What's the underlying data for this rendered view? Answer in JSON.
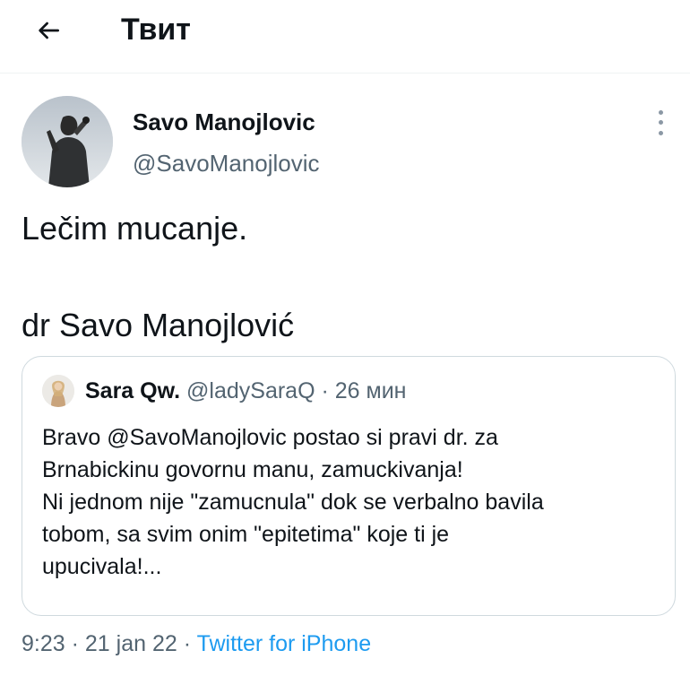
{
  "header": {
    "title": "Твит",
    "back_icon": "arrow-left-icon"
  },
  "tweet": {
    "author_name": "Savo Manojlovic",
    "author_handle": "@SavoManojlovic",
    "more_icon": "more-vertical-icon",
    "text_lines": [
      "Lečim mucanje.",
      "",
      "dr Savo Manojlović"
    ],
    "time": "9:23",
    "date": "21 jan 22",
    "separator": "·",
    "source": "Twitter for iPhone"
  },
  "quote": {
    "author_name": "Sara Qw.",
    "author_handle": "@ladySaraQ",
    "separator": "·",
    "time_ago": "26 мин",
    "body_lines": [
      "Bravo @SavoManojlovic postao si pravi dr. za",
      "Brnabickinu govornu manu, zamuckivanja!",
      "Ni jednom nije \"zamucnula\" dok se verbalno bavila",
      "tobom, sa svim onim \"epitetima\" koje ti je",
      "upucivala!..."
    ]
  },
  "colors": {
    "text_primary": "#0f1419",
    "text_secondary": "#536471",
    "link": "#1d9bf0",
    "border": "#cfd9de"
  }
}
